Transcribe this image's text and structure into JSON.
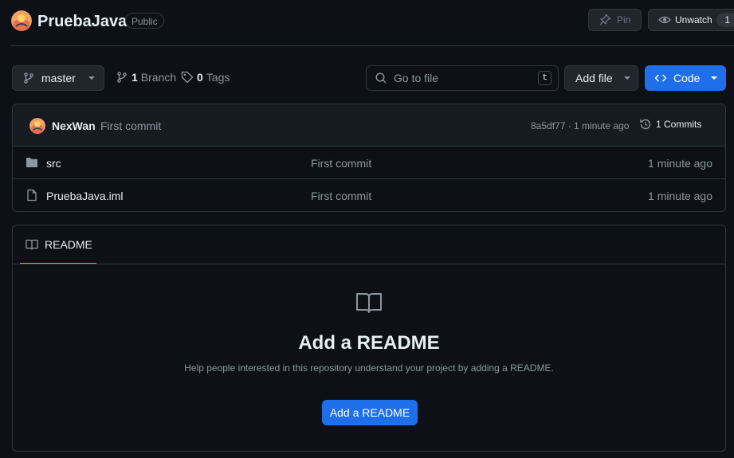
{
  "repo": {
    "name": "PruebaJava",
    "visibility": "Public"
  },
  "actions": {
    "pin_label": "Pin",
    "watch_label": "Unwatch",
    "watch_count": "1"
  },
  "toolbar": {
    "branch_name": "master",
    "branch_count": "1",
    "branch_label": "Branch",
    "tag_count": "0",
    "tag_label": "Tags",
    "search_placeholder": "Go to file",
    "search_shortcut": "t",
    "add_file_label": "Add file",
    "code_label": "Code"
  },
  "latest_commit": {
    "author": "NexWan",
    "message": "First commit",
    "meta": "8a5df77 · 1 minute ago",
    "commits_label": "1 Commits"
  },
  "files": [
    {
      "type": "folder",
      "name": "src",
      "message": "First commit",
      "time": "1 minute ago"
    },
    {
      "type": "file",
      "name": "PruebaJava.iml",
      "message": "First commit",
      "time": "1 minute ago"
    }
  ],
  "readme": {
    "tab_label": "README",
    "empty_title": "Add a README",
    "empty_description": "Help people interested in this repository understand your project by adding a README.",
    "button_label": "Add a README"
  },
  "colors": {
    "background": "#0d1117",
    "border": "#30363d",
    "primary_button": "#1f6feb",
    "active_tab_underline": "#f78166",
    "muted_text": "#8d96a0"
  }
}
